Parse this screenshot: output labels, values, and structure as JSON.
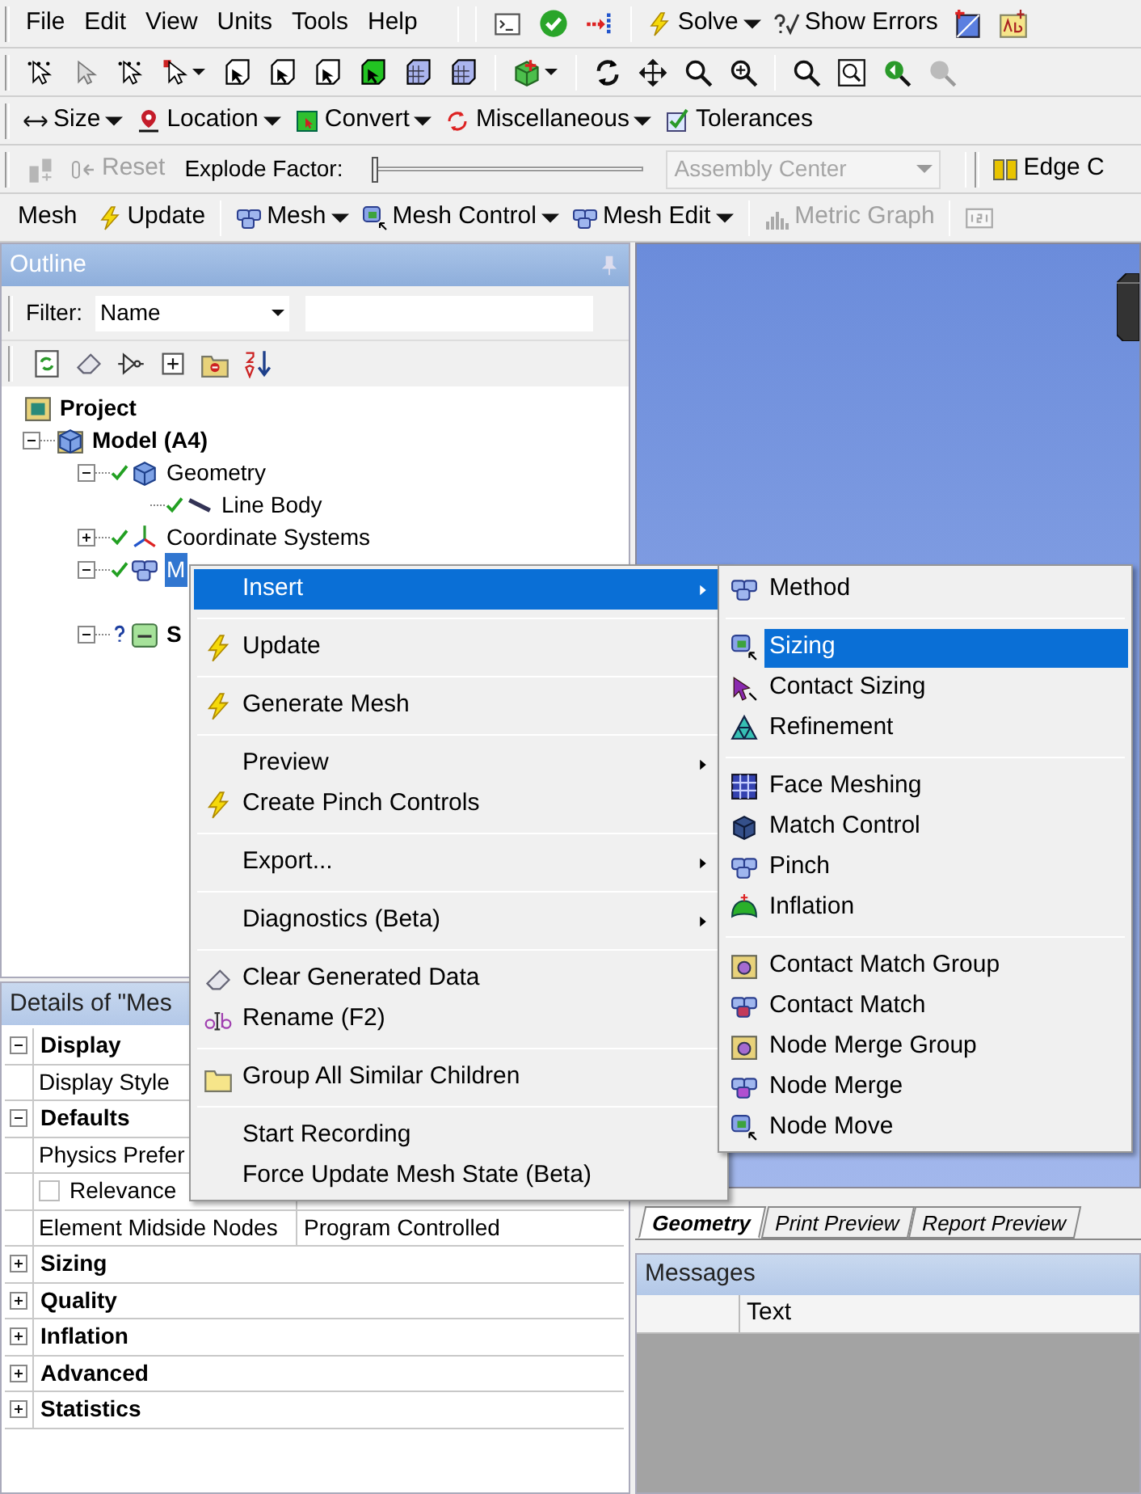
{
  "menu_bar": [
    {
      "label": "File"
    },
    {
      "label": "Edit"
    },
    {
      "label": "View"
    },
    {
      "label": "Units"
    },
    {
      "label": "Tools"
    },
    {
      "label": "Help"
    }
  ],
  "solve_toolbar": {
    "solve": {
      "label": "Solve",
      "dropdown": true
    },
    "show_errors": {
      "label": "Show Errors"
    }
  },
  "context_toolbar": [
    {
      "label": "Size",
      "dropdown": true
    },
    {
      "label": "Location",
      "dropdown": true
    },
    {
      "label": "Convert",
      "dropdown": true
    },
    {
      "label": "Miscellaneous",
      "dropdown": true
    },
    {
      "label": "Tolerances",
      "dropdown": false
    }
  ],
  "explode_toolbar": {
    "reset": {
      "label": "Reset",
      "disabled": true
    },
    "factor_label": "Explode Factor:",
    "factor_slider": {
      "level": 0
    },
    "center": {
      "value": "Assembly Center",
      "disabled": true
    },
    "edge": {
      "label": "Edge C"
    }
  },
  "mesh_toolbar": {
    "title": "Mesh",
    "buttons": [
      {
        "label": "Update",
        "dropdown": false,
        "disabled": false
      },
      {
        "label": "Mesh",
        "dropdown": true,
        "disabled": false
      },
      {
        "label": "Mesh Control",
        "dropdown": true,
        "disabled": false
      },
      {
        "label": "Mesh Edit",
        "dropdown": true,
        "disabled": false
      },
      {
        "label": "Metric Graph",
        "dropdown": false,
        "disabled": true
      }
    ]
  },
  "outline": {
    "title": "Outline",
    "filter_label": "Filter:",
    "filter_value": "Name",
    "tree": [
      {
        "label": "Project",
        "bold": true,
        "selected": false,
        "children": [
          {
            "label": "Model (A4)",
            "bold": true,
            "selected": false,
            "expanded": true,
            "children": [
              {
                "label": "Geometry",
                "bold": false,
                "selected": false,
                "updated": true,
                "expanded": true,
                "children": [
                  {
                    "label": "Line Body",
                    "bold": false,
                    "selected": false,
                    "updated": true
                  }
                ]
              },
              {
                "label": "Coordinate Systems",
                "bold": false,
                "selected": false,
                "updated": true,
                "expanded": false
              },
              {
                "label": "M",
                "bold": false,
                "selected": true,
                "updated": true,
                "expanded": true
              },
              {
                "label": "S",
                "bold": true,
                "selected": false,
                "updated": false,
                "expanded": true
              }
            ]
          }
        ]
      }
    ]
  },
  "details": {
    "title": "Details of \"Mes",
    "rows": [
      {
        "kind": "group",
        "label": "Display",
        "expanded": true
      },
      {
        "kind": "property",
        "label": "Display Style"
      },
      {
        "kind": "group",
        "label": "Defaults",
        "expanded": true
      },
      {
        "kind": "property",
        "label": "Physics Prefer"
      },
      {
        "kind": "checkbox",
        "label": "Relevance",
        "checked": false
      },
      {
        "kind": "property",
        "label": "Element Midside Nodes",
        "value": "Program Controlled"
      },
      {
        "kind": "group",
        "label": "Sizing",
        "expanded": false
      },
      {
        "kind": "group",
        "label": "Quality",
        "expanded": false
      },
      {
        "kind": "group",
        "label": "Inflation",
        "expanded": false
      },
      {
        "kind": "group",
        "label": "Advanced",
        "expanded": false
      },
      {
        "kind": "group",
        "label": "Statistics",
        "expanded": false
      }
    ]
  },
  "view_tabs": [
    {
      "label": "Geometry",
      "selected": true
    },
    {
      "label": "Print Preview",
      "selected": false
    },
    {
      "label": "Report Preview",
      "selected": false
    }
  ],
  "messages": {
    "title": "Messages",
    "columns": [
      "Text"
    ]
  },
  "context_menu": {
    "groups": [
      [
        {
          "label": "Insert",
          "selected": true,
          "submenu": true
        }
      ],
      [
        {
          "label": "Update",
          "selected": false,
          "submenu": false
        }
      ],
      [
        {
          "label": "Generate Mesh",
          "selected": false,
          "submenu": false
        }
      ],
      [
        {
          "label": "Preview",
          "selected": false,
          "submenu": true
        },
        {
          "label": "Create Pinch Controls",
          "selected": false,
          "submenu": false
        }
      ],
      [
        {
          "label": "Export...",
          "selected": false,
          "submenu": true
        }
      ],
      [
        {
          "label": "Diagnostics (Beta)",
          "selected": false,
          "submenu": true
        }
      ],
      [
        {
          "label": "Clear Generated Data",
          "selected": false,
          "submenu": false
        },
        {
          "label": "Rename (F2)",
          "selected": false,
          "submenu": false
        }
      ],
      [
        {
          "label": "Group All Similar Children",
          "selected": false,
          "submenu": false
        }
      ],
      [
        {
          "label": "Start Recording",
          "selected": false,
          "submenu": false
        },
        {
          "label": "Force Update Mesh State (Beta)",
          "selected": false,
          "submenu": false
        }
      ]
    ]
  },
  "insert_submenu": {
    "groups": [
      [
        {
          "label": "Method",
          "selected": false
        }
      ],
      [
        {
          "label": "Sizing",
          "selected": true
        },
        {
          "label": "Contact Sizing",
          "selected": false
        },
        {
          "label": "Refinement",
          "selected": false
        }
      ],
      [
        {
          "label": "Face Meshing",
          "selected": false
        },
        {
          "label": "Match Control",
          "selected": false
        },
        {
          "label": "Pinch",
          "selected": false
        },
        {
          "label": "Inflation",
          "selected": false
        }
      ],
      [
        {
          "label": "Contact Match Group",
          "selected": false
        },
        {
          "label": "Contact Match",
          "selected": false
        },
        {
          "label": "Node Merge Group",
          "selected": false
        },
        {
          "label": "Node Merge",
          "selected": false
        },
        {
          "label": "Node Move",
          "selected": false
        }
      ]
    ]
  }
}
